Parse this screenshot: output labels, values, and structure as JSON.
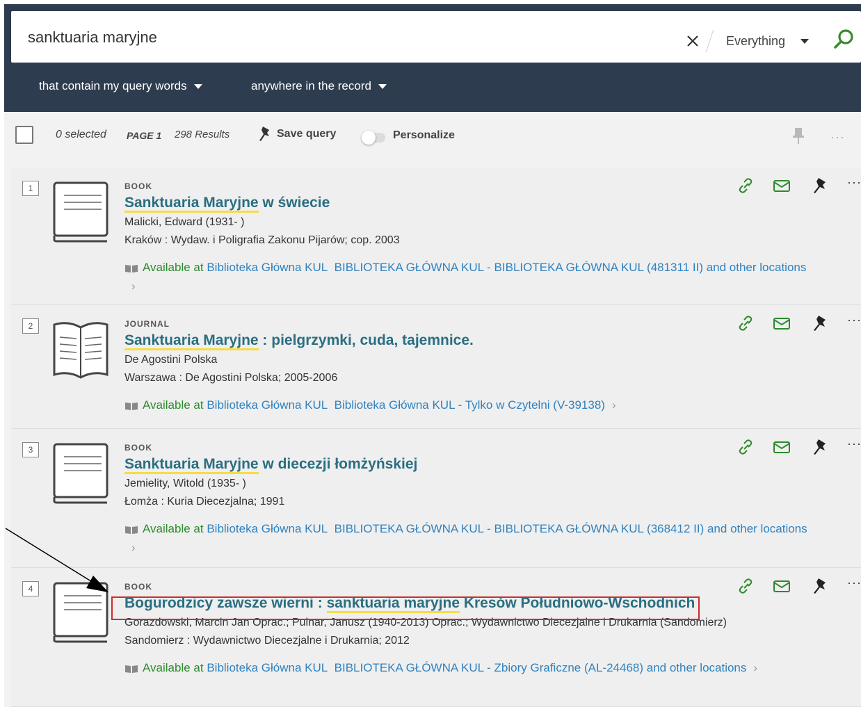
{
  "search": {
    "query": "sanktuaria maryjne",
    "scope": "Everything",
    "filters": [
      "that contain my query words",
      "anywhere in the record"
    ]
  },
  "toolbar": {
    "selected": "0 selected",
    "page": "PAGE 1",
    "results": "298 Results",
    "save_query": "Save query",
    "personalize": "Personalize",
    "personalize_on": false,
    "more": "···"
  },
  "results": [
    {
      "num": "1",
      "type": "BOOK",
      "title_hl": "Sanktuaria Maryjne",
      "title_rest": " w świecie",
      "author": "Malicki, Edward (1931- )",
      "publisher": "Kraków : Wydaw. i Poligrafia Zakonu Pijarów; cop. 2003",
      "avail_label": "Available at",
      "library": "Biblioteka Główna KUL",
      "location": "BIBLIOTEKA GŁÓWNA KUL - BIBLIOTEKA GŁÓWNA KUL (481311 II) and other locations"
    },
    {
      "num": "2",
      "type": "JOURNAL",
      "title_hl": "Sanktuaria Maryjne",
      "title_rest": " : pielgrzymki, cuda, tajemnice.",
      "author": "De Agostini Polska",
      "publisher": "Warszawa : De Agostini Polska; 2005-2006",
      "avail_label": "Available at",
      "library": "Biblioteka Główna KUL",
      "location": "Biblioteka Główna KUL - Tylko w Czytelni (V-39138)"
    },
    {
      "num": "3",
      "type": "BOOK",
      "title_hl": "Sanktuaria Maryjne",
      "title_rest": " w diecezji łomżyńskiej",
      "author": "Jemielity, Witold (1935- )",
      "publisher": "Łomża : Kuria Diecezjalna; 1991",
      "avail_label": "Available at",
      "library": "Biblioteka Główna KUL",
      "location": "BIBLIOTEKA GŁÓWNA KUL - BIBLIOTEKA GŁÓWNA KUL (368412 II) and other locations"
    },
    {
      "num": "4",
      "type": "BOOK",
      "title_pre": "Bogurodzicy zawsze wierni : ",
      "title_hl": "sanktuaria maryjne",
      "title_rest": " Kresów Południowo-Wschodnich",
      "author": "Gorazdowski, Marcin Jan Oprac.; Pulnar, Janusz (1940-2013) Oprac.; Wydawnictwo Diecezjalne i Drukarnia (Sandomierz)",
      "publisher": "Sandomierz : Wydawnictwo Diecezjalne i Drukarnia; 2012",
      "avail_label": "Available at",
      "library": "Biblioteka Główna KUL",
      "location": "BIBLIOTEKA GŁÓWNA KUL - Zbiory Graficzne (AL-24468) and other locations"
    }
  ],
  "colors": {
    "header_bg": "#2e3c4f",
    "link": "#2a6e81",
    "available": "#2c8a2c",
    "highlight": "#f5dd44",
    "annotation": "#d12b2b"
  }
}
